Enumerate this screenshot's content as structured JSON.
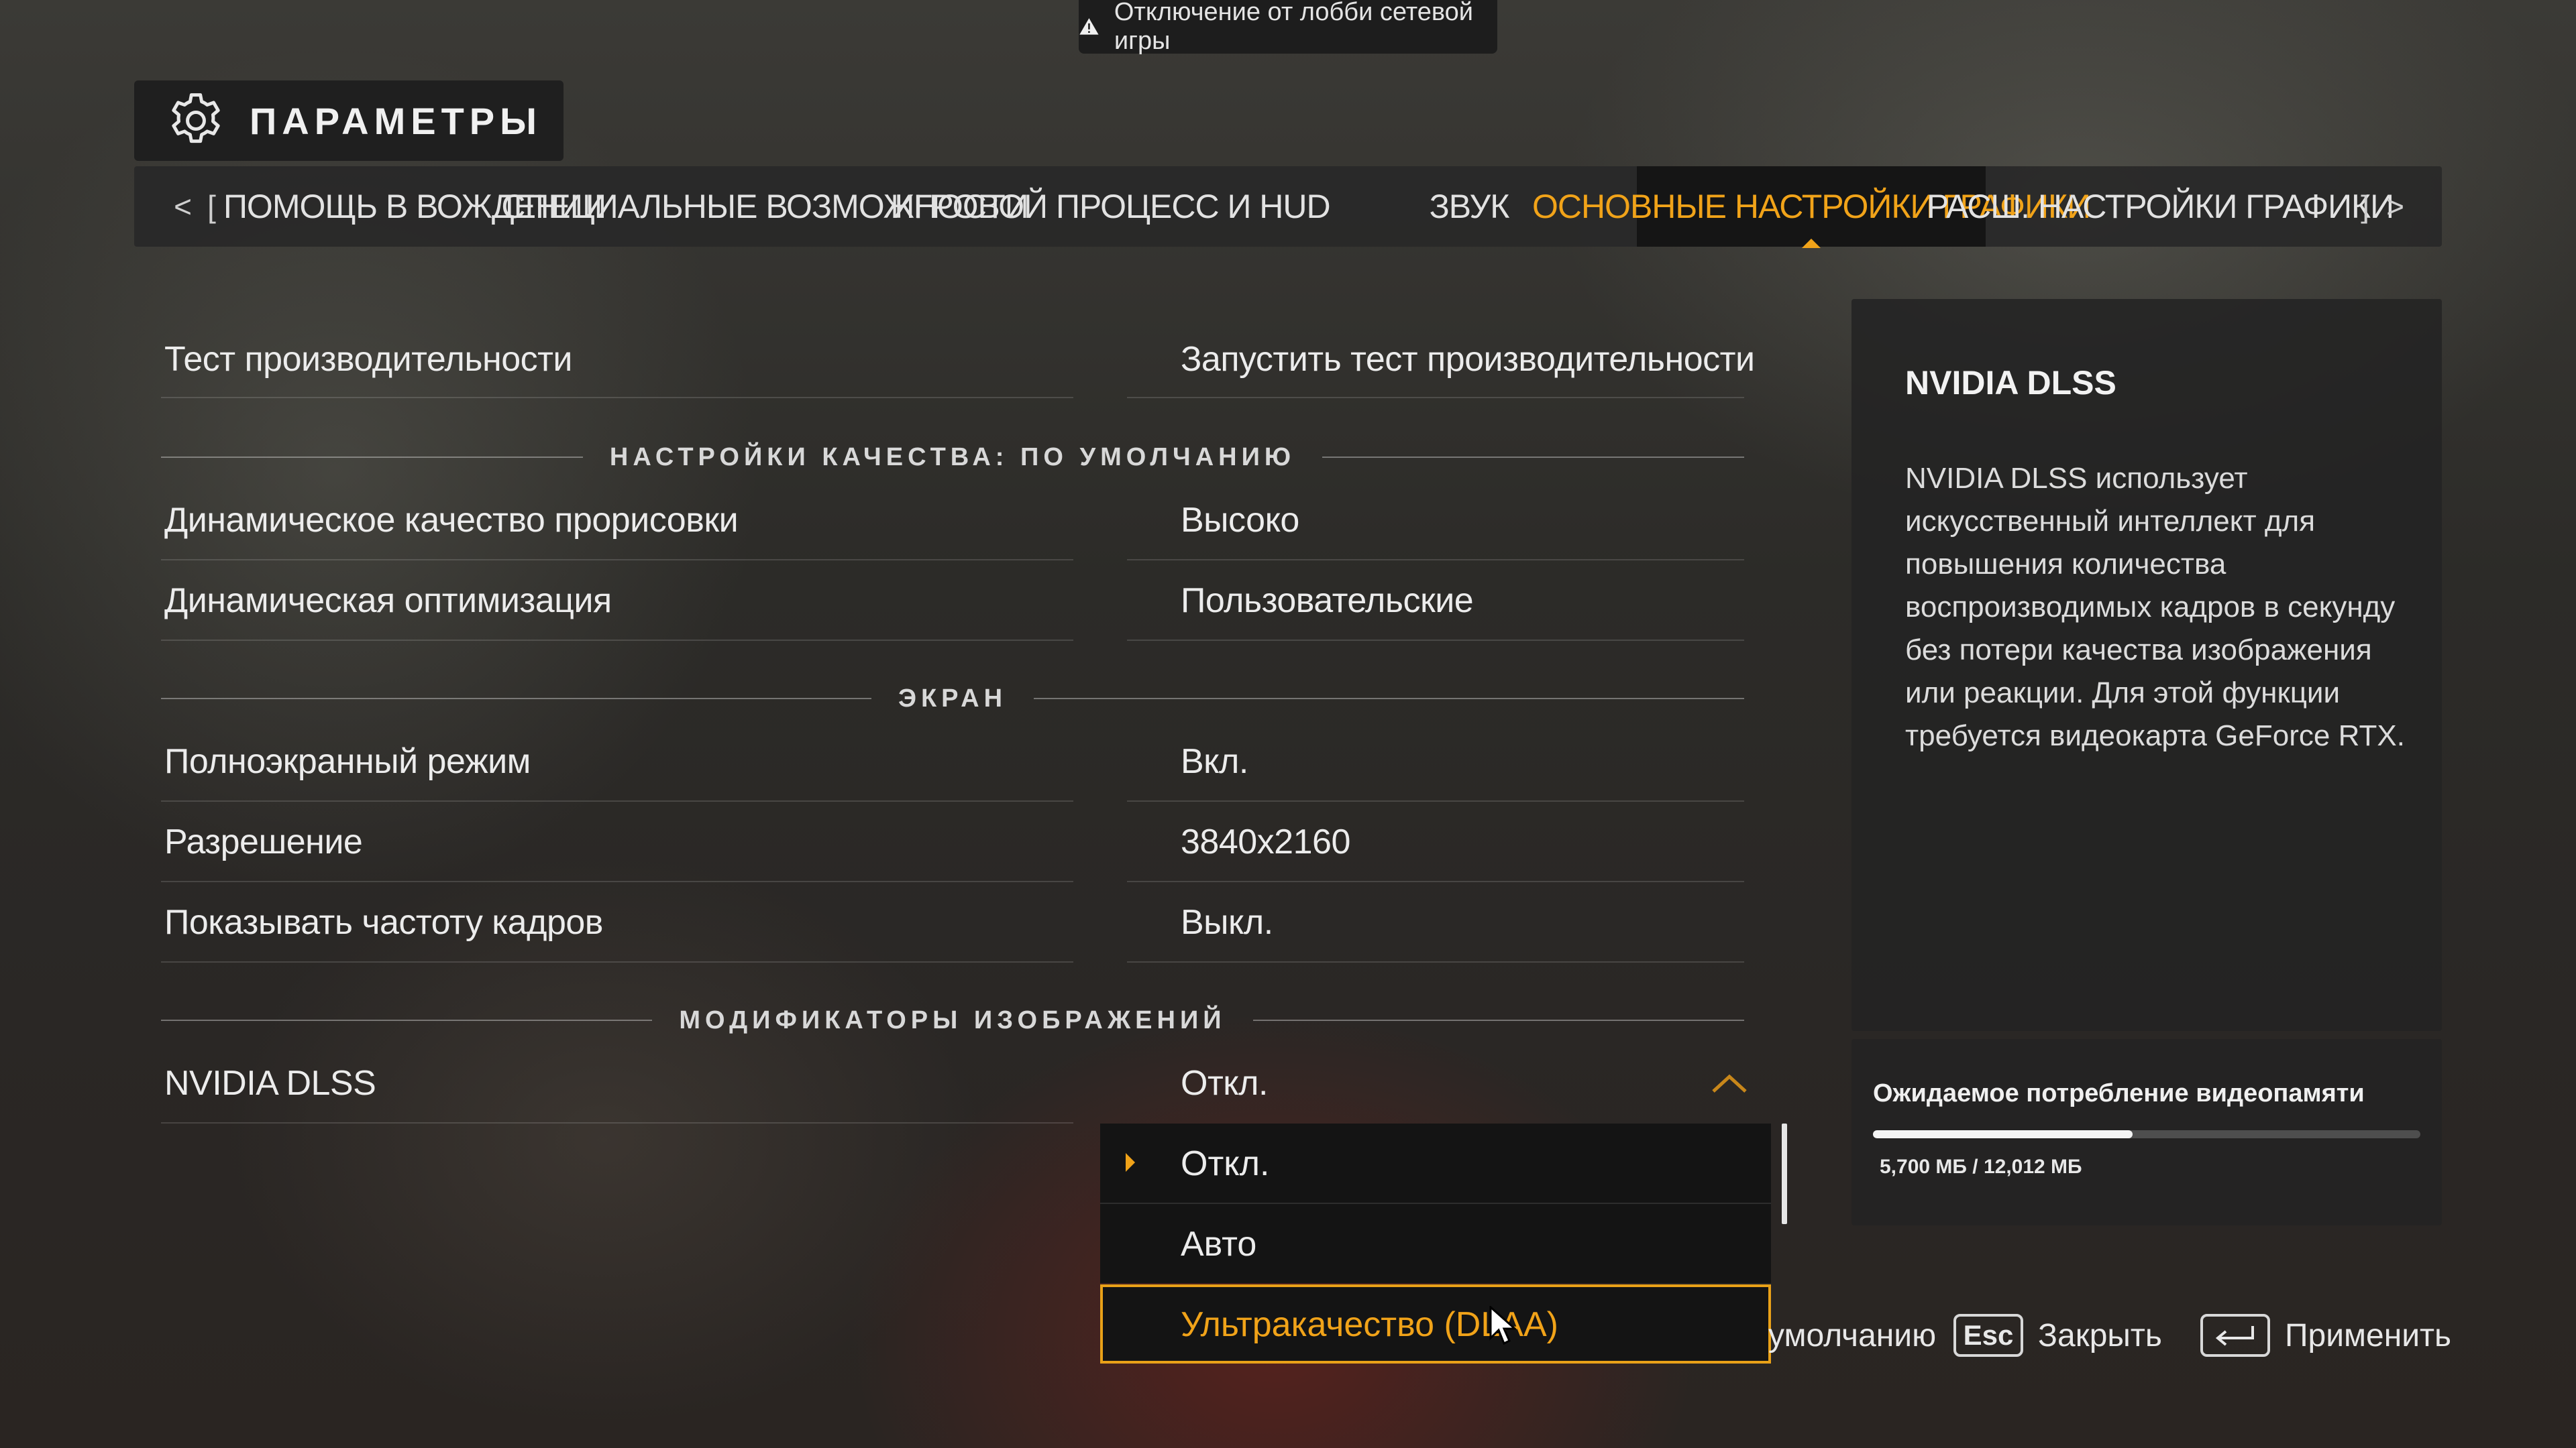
{
  "toast": {
    "text": "Отключение от лобби сетевой игры",
    "icon": "warning-icon"
  },
  "header": {
    "title": "ПАРАМЕТРЫ",
    "icon": "gear-icon"
  },
  "tabs": {
    "prev_arrow": "<",
    "prev_bracket": "[",
    "next_bracket": "]",
    "next_arrow": ">",
    "items": [
      {
        "label": "ПОМОЩЬ В ВОЖДЕНИИ"
      },
      {
        "label": "СПЕЦИАЛЬНЫЕ ВОЗМОЖНОСТИ"
      },
      {
        "label": "ИГРОВОЙ ПРОЦЕСС И HUD"
      },
      {
        "label": "ЗВУК"
      },
      {
        "label": "ОСНОВНЫЕ НАСТРОЙКИ ГРАФИКИ",
        "active": true
      },
      {
        "label": "РАСШ. НАСТРОЙКИ ГРАФИКИ"
      }
    ],
    "accent_color": "#f1a319"
  },
  "settings": {
    "benchmark": {
      "label": "Тест производительности",
      "value": "Запустить тест производительности"
    },
    "section_quality": "НАСТРОЙКИ КАЧЕСТВА: ПО УМОЛЧАНИЮ",
    "dynamic_render": {
      "label": "Динамическое качество прорисовки",
      "value": "Высоко"
    },
    "dynamic_opt": {
      "label": "Динамическая оптимизация",
      "value": "Пользовательские"
    },
    "section_screen": "ЭКРАН",
    "fullscreen": {
      "label": "Полноэкранный режим",
      "value": "Вкл."
    },
    "resolution": {
      "label": "Разрешение",
      "value": "3840x2160"
    },
    "show_fps": {
      "label": "Показывать частоту кадров",
      "value": "Выкл."
    },
    "section_modifiers": "МОДИФИКАТОРЫ ИЗОБРАЖЕНИЙ",
    "dlss": {
      "label": "NVIDIA DLSS",
      "value": "Откл."
    }
  },
  "dropdown": {
    "options": [
      {
        "label": "Откл.",
        "selected": true
      },
      {
        "label": "Авто"
      },
      {
        "label": "Ультракачество (DLAA)",
        "highlighted": true
      }
    ]
  },
  "info_panel": {
    "title": "NVIDIA DLSS",
    "body": "NVIDIA DLSS использует искусственный интеллект для повышения количества воспроизводимых кадров в секунду без потери качества изображения или реакции. Для этой функции требуется видеокарта GeForce RTX."
  },
  "vram": {
    "title": "Ожидаемое потребление видеопамяти",
    "usage_text": "5,700 МБ / 12,012 МБ",
    "used_fraction": 0.4745
  },
  "actions": {
    "defaults_label": "умолчанию",
    "close_key": "Esc",
    "close_label": "Закрыть",
    "apply_key_icon": "enter-icon",
    "apply_label": "Применить"
  }
}
